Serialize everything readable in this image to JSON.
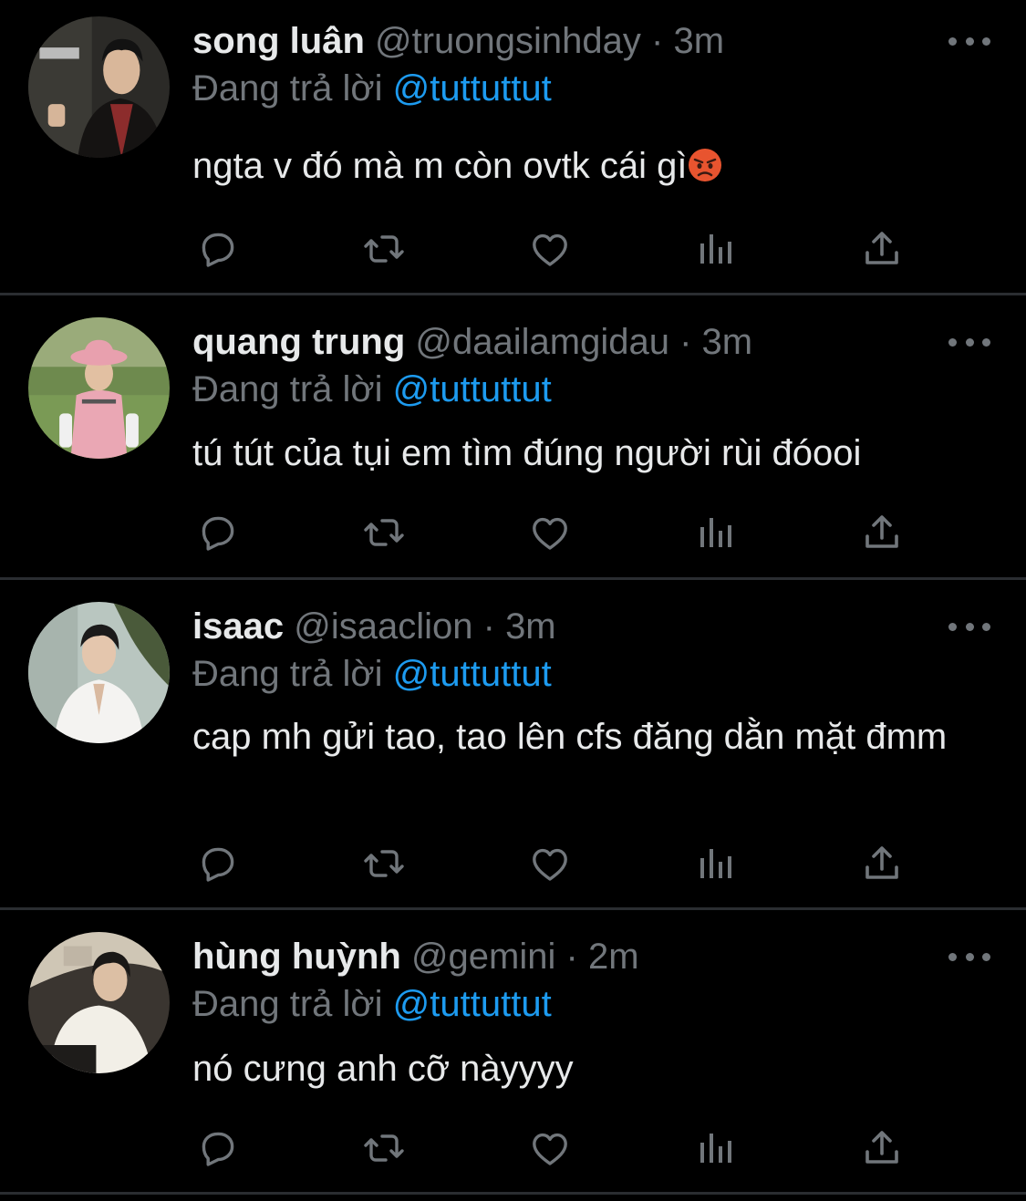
{
  "tweets": [
    {
      "name": "song luân",
      "handle": "@truongsinhday",
      "dot": "·",
      "time": "3m",
      "reply_prefix": "Đang trả lời",
      "reply_to": "@tuttuttut",
      "text": "ngta v đó mà m còn ovtk cái gì",
      "emoji": "pouting-face"
    },
    {
      "name": "quang trung",
      "handle": "@daailamgidau",
      "dot": "·",
      "time": "3m",
      "reply_prefix": "Đang trả lời",
      "reply_to": "@tuttuttut",
      "text": "tú tút của tụi em tìm đúng người rùi đóooi"
    },
    {
      "name": "isaac",
      "handle": "@isaaclion",
      "dot": "·",
      "time": "3m",
      "reply_prefix": "Đang trả lời",
      "reply_to": "@tuttuttut",
      "text": "cap mh gửi tao, tao lên cfs đăng dằn mặt đmm"
    },
    {
      "name": "hùng huỳnh",
      "handle": "@gemini",
      "dot": "·",
      "time": "2m",
      "reply_prefix": "Đang trả lời",
      "reply_to": "@tuttuttut",
      "text": "nó cưng anh cỡ nàyyyy"
    }
  ],
  "action_icons": [
    "reply-icon",
    "retweet-icon",
    "like-icon",
    "analytics-icon",
    "share-icon"
  ],
  "colors": {
    "background": "#000000",
    "text": "#e7e9ea",
    "muted": "#71767b",
    "link": "#1d9bf0",
    "divider": "#2a2d31"
  }
}
